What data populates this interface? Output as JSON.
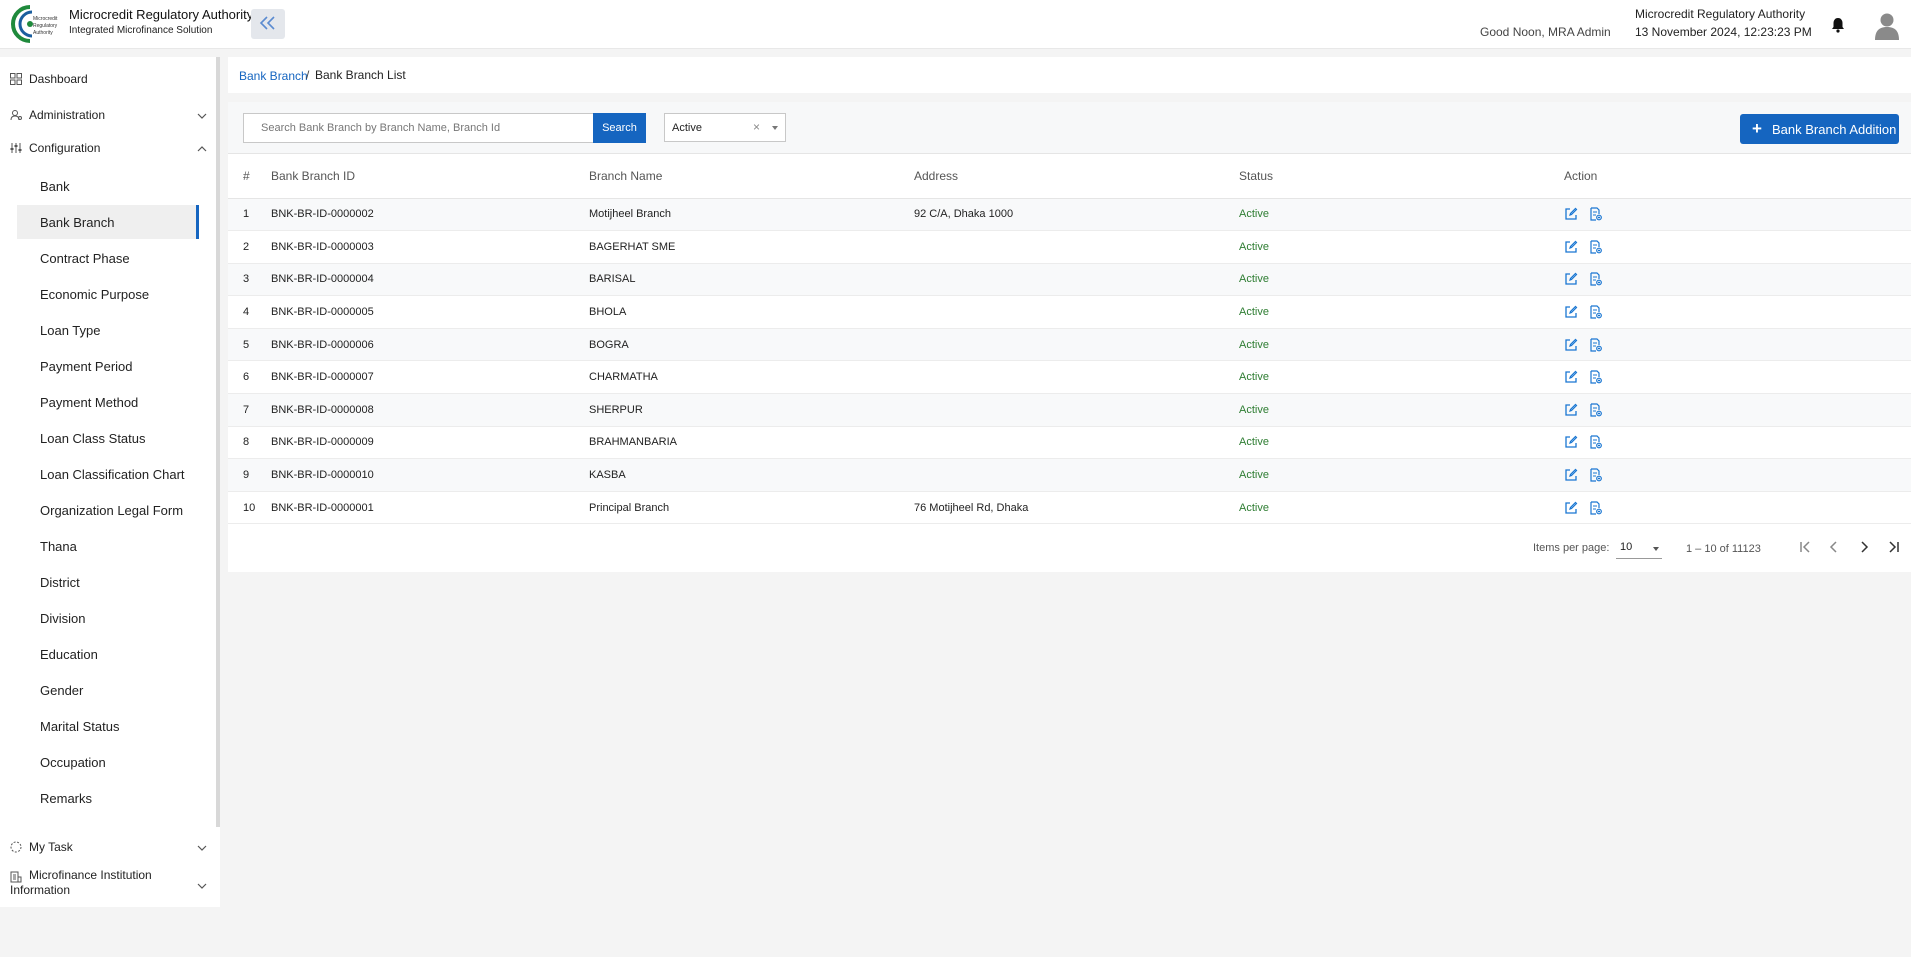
{
  "header": {
    "title": "Microcredit Regulatory Authority",
    "subtitle": "Integrated Microfinance Solution",
    "logo_text": "Microcredit Regulatory Authority",
    "greeting": "Good Noon, MRA Admin",
    "org_name": "Microcredit Regulatory Authority",
    "datetime": "13 November 2024, 12:23:23 PM"
  },
  "sidebar": {
    "dashboard": "Dashboard",
    "administration": "Administration",
    "configuration": "Configuration",
    "config_items": [
      {
        "label": "Bank"
      },
      {
        "label": "Bank Branch"
      },
      {
        "label": "Contract Phase"
      },
      {
        "label": "Economic Purpose"
      },
      {
        "label": "Loan Type"
      },
      {
        "label": "Payment Period"
      },
      {
        "label": "Payment Method"
      },
      {
        "label": "Loan Class Status"
      },
      {
        "label": "Loan Classification Chart"
      },
      {
        "label": "Organization Legal Form"
      },
      {
        "label": "Thana"
      },
      {
        "label": "District"
      },
      {
        "label": "Division"
      },
      {
        "label": "Education"
      },
      {
        "label": "Gender"
      },
      {
        "label": "Marital Status"
      },
      {
        "label": "Occupation"
      },
      {
        "label": "Remarks"
      }
    ],
    "active_item": "Bank Branch",
    "my_task": "My Task",
    "mfi_info": "Microfinance Institution Information"
  },
  "breadcrumb": {
    "parent": "Bank Branch",
    "separator": "/",
    "current": "Bank Branch List"
  },
  "toolbar": {
    "search_placeholder": "Search Bank Branch by Branch Name, Branch Id",
    "search_button": "Search",
    "status_value": "Active",
    "add_button": "Bank Branch Addition"
  },
  "table": {
    "headers": [
      "#",
      "Bank Branch ID",
      "Branch Name",
      "Address",
      "Status",
      "Action"
    ],
    "rows": [
      {
        "num": "1",
        "id": "BNK-BR-ID-0000002",
        "name": "Motijheel Branch",
        "address": "92 C/A, Dhaka 1000",
        "status": "Active"
      },
      {
        "num": "2",
        "id": "BNK-BR-ID-0000003",
        "name": "BAGERHAT SME",
        "address": "",
        "status": "Active"
      },
      {
        "num": "3",
        "id": "BNK-BR-ID-0000004",
        "name": "BARISAL",
        "address": "",
        "status": "Active"
      },
      {
        "num": "4",
        "id": "BNK-BR-ID-0000005",
        "name": "BHOLA",
        "address": "",
        "status": "Active"
      },
      {
        "num": "5",
        "id": "BNK-BR-ID-0000006",
        "name": "BOGRA",
        "address": "",
        "status": "Active"
      },
      {
        "num": "6",
        "id": "BNK-BR-ID-0000007",
        "name": "CHARMATHA",
        "address": "",
        "status": "Active"
      },
      {
        "num": "7",
        "id": "BNK-BR-ID-0000008",
        "name": "SHERPUR",
        "address": "",
        "status": "Active"
      },
      {
        "num": "8",
        "id": "BNK-BR-ID-0000009",
        "name": "BRAHMANBARIA",
        "address": "",
        "status": "Active"
      },
      {
        "num": "9",
        "id": "BNK-BR-ID-0000010",
        "name": "KASBA",
        "address": "",
        "status": "Active"
      },
      {
        "num": "10",
        "id": "BNK-BR-ID-0000001",
        "name": "Principal Branch",
        "address": "76 Motijheel Rd, Dhaka",
        "status": "Active"
      }
    ]
  },
  "pagination": {
    "items_per_page_label": "Items per page:",
    "items_per_page": "10",
    "range": "1 – 10 of 11123"
  },
  "colors": {
    "primary": "#1565c0",
    "status_active": "#2e7d32",
    "logo_green": "#1f8a3c"
  },
  "icons": [
    "collapse-icon",
    "bell-icon",
    "avatar-icon",
    "dashboard-icon",
    "administration-icon",
    "configuration-icon",
    "chevron-down-icon",
    "chevron-up-icon",
    "task-icon",
    "institution-icon",
    "plus-icon",
    "edit-icon",
    "document-view-icon",
    "first-page-icon",
    "prev-page-icon",
    "next-page-icon",
    "last-page-icon"
  ]
}
